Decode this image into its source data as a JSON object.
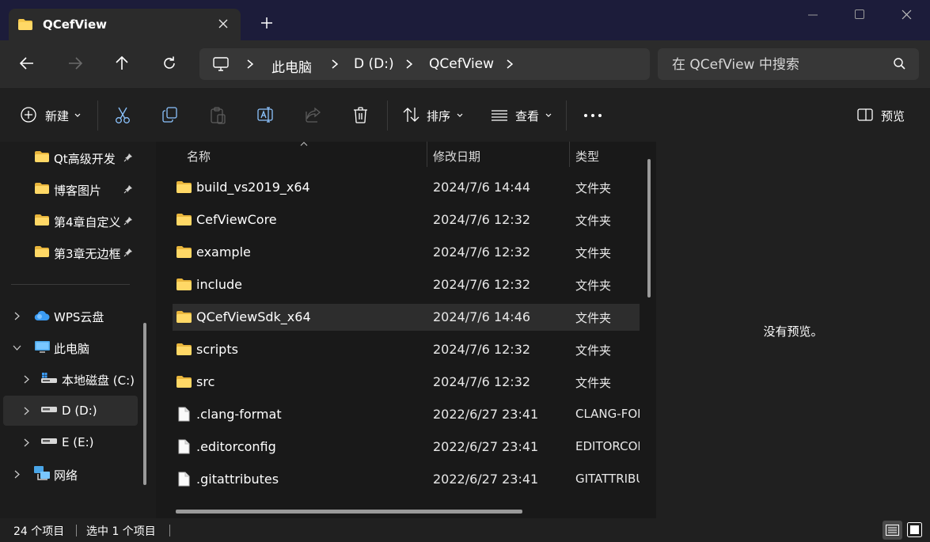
{
  "window": {
    "tab_title": "QCefView",
    "accent_folder": "#f6c84c"
  },
  "address": {
    "segments": [
      "此电脑",
      "D (D:)",
      "QCefView"
    ],
    "search_placeholder": "在 QCefView 中搜索"
  },
  "toolbar": {
    "new_label": "新建",
    "sort_label": "排序",
    "view_label": "查看",
    "preview_label": "预览"
  },
  "sidebar": {
    "pinned": [
      {
        "label": "Qt高级开发"
      },
      {
        "label": "博客图片"
      },
      {
        "label": "第4章自定义:"
      },
      {
        "label": "第3章无边框"
      }
    ],
    "tree": [
      {
        "label": "WPS云盘",
        "icon": "cloud-icon"
      },
      {
        "label": "此电脑",
        "icon": "computer-icon"
      },
      {
        "label": "本地磁盘 (C:)",
        "icon": "windows-drive-icon"
      },
      {
        "label": "D (D:)",
        "icon": "drive-icon"
      },
      {
        "label": "E (E:)",
        "icon": "drive-icon"
      },
      {
        "label": "网络",
        "icon": "network-icon"
      }
    ]
  },
  "filelist": {
    "columns": {
      "name": "名称",
      "date": "修改日期",
      "type": "类型"
    },
    "rows": [
      {
        "name": "build_vs2019_x64",
        "date": "2024/7/6 14:44",
        "type": "文件夹",
        "kind": "folder"
      },
      {
        "name": "CefViewCore",
        "date": "2024/7/6 12:32",
        "type": "文件夹",
        "kind": "folder"
      },
      {
        "name": "example",
        "date": "2024/7/6 12:32",
        "type": "文件夹",
        "kind": "folder"
      },
      {
        "name": "include",
        "date": "2024/7/6 12:32",
        "type": "文件夹",
        "kind": "folder"
      },
      {
        "name": "QCefViewSdk_x64",
        "date": "2024/7/6 14:46",
        "type": "文件夹",
        "kind": "folder"
      },
      {
        "name": "scripts",
        "date": "2024/7/6 12:32",
        "type": "文件夹",
        "kind": "folder"
      },
      {
        "name": "src",
        "date": "2024/7/6 12:32",
        "type": "文件夹",
        "kind": "folder"
      },
      {
        "name": ".clang-format",
        "date": "2022/6/27 23:41",
        "type": "CLANG-FOI",
        "kind": "file"
      },
      {
        "name": ".editorconfig",
        "date": "2022/6/27 23:41",
        "type": "EDITORCOI",
        "kind": "file"
      },
      {
        "name": ".gitattributes",
        "date": "2022/6/27 23:41",
        "type": "GITATTRIBU",
        "kind": "file"
      }
    ]
  },
  "preview": {
    "message": "没有预览。"
  },
  "status": {
    "item_count": "24 个项目",
    "selected": "选中 1 个项目"
  }
}
